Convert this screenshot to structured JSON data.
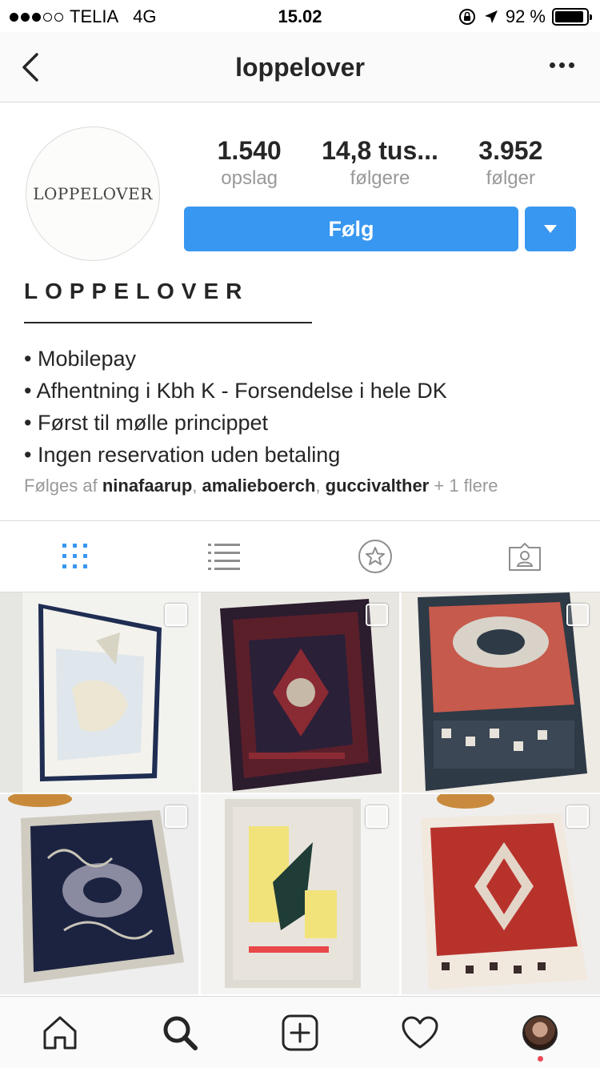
{
  "status_bar": {
    "carrier": "TELIA",
    "network": "4G",
    "time": "15.02",
    "battery": "92 %",
    "battery_level": 0.92
  },
  "nav": {
    "title": "loppelover"
  },
  "profile": {
    "avatar_text": "LOPPELOVER",
    "stats": [
      {
        "value": "1.540",
        "label": "opslag"
      },
      {
        "value": "14,8 tus...",
        "label": "følgere"
      },
      {
        "value": "3.952",
        "label": "følger"
      }
    ],
    "follow_label": "Følg"
  },
  "bio": {
    "name": "LOPPELOVER",
    "lines": [
      "• Mobilepay",
      "• Afhentning i Kbh K - Forsendelse i hele DK",
      "• Først til mølle princippet",
      "• Ingen reservation uden betaling"
    ],
    "followed_by_prefix": "Følges af",
    "followed_by_users": [
      "ninafaarup",
      "amalieboerch",
      "guccivalther"
    ],
    "followed_by_suffix": "+ 1 flere"
  },
  "tabs": [
    {
      "name": "grid",
      "icon": "grid-icon",
      "active": true
    },
    {
      "name": "list",
      "icon": "list-icon",
      "active": false
    },
    {
      "name": "saved",
      "icon": "star-icon",
      "active": false
    },
    {
      "name": "tagged",
      "icon": "tagged-person-icon",
      "active": false
    }
  ],
  "posts": [
    {
      "subject": "framed-art-print",
      "colors": [
        "#f2f2ef",
        "#dfe6ec",
        "#1f2d52"
      ]
    },
    {
      "subject": "persian-rug-dark",
      "colors": [
        "#2b1c2e",
        "#8a2a33",
        "#e8e6e0"
      ]
    },
    {
      "subject": "persian-rug-red",
      "colors": [
        "#c65a4c",
        "#2e3a46",
        "#eeeae4"
      ]
    },
    {
      "subject": "persian-rug-navy",
      "colors": [
        "#1c2340",
        "#cfcbc0",
        "#eeeeee"
      ]
    },
    {
      "subject": "framed-abstract-print",
      "colors": [
        "#e8e4dc",
        "#f2e27a",
        "#1f3d36"
      ]
    },
    {
      "subject": "persian-rug-red-white",
      "colors": [
        "#b8322c",
        "#f1e8de",
        "#3a2c2a"
      ]
    }
  ],
  "bottom_nav": [
    {
      "icon": "home-icon"
    },
    {
      "icon": "search-icon",
      "active": true
    },
    {
      "icon": "add-post-icon"
    },
    {
      "icon": "heart-icon"
    },
    {
      "icon": "profile-avatar",
      "notification": true
    }
  ],
  "colors": {
    "accent": "#3897f0",
    "text": "#262626",
    "muted": "#999999",
    "divider": "#dbdbdb"
  }
}
